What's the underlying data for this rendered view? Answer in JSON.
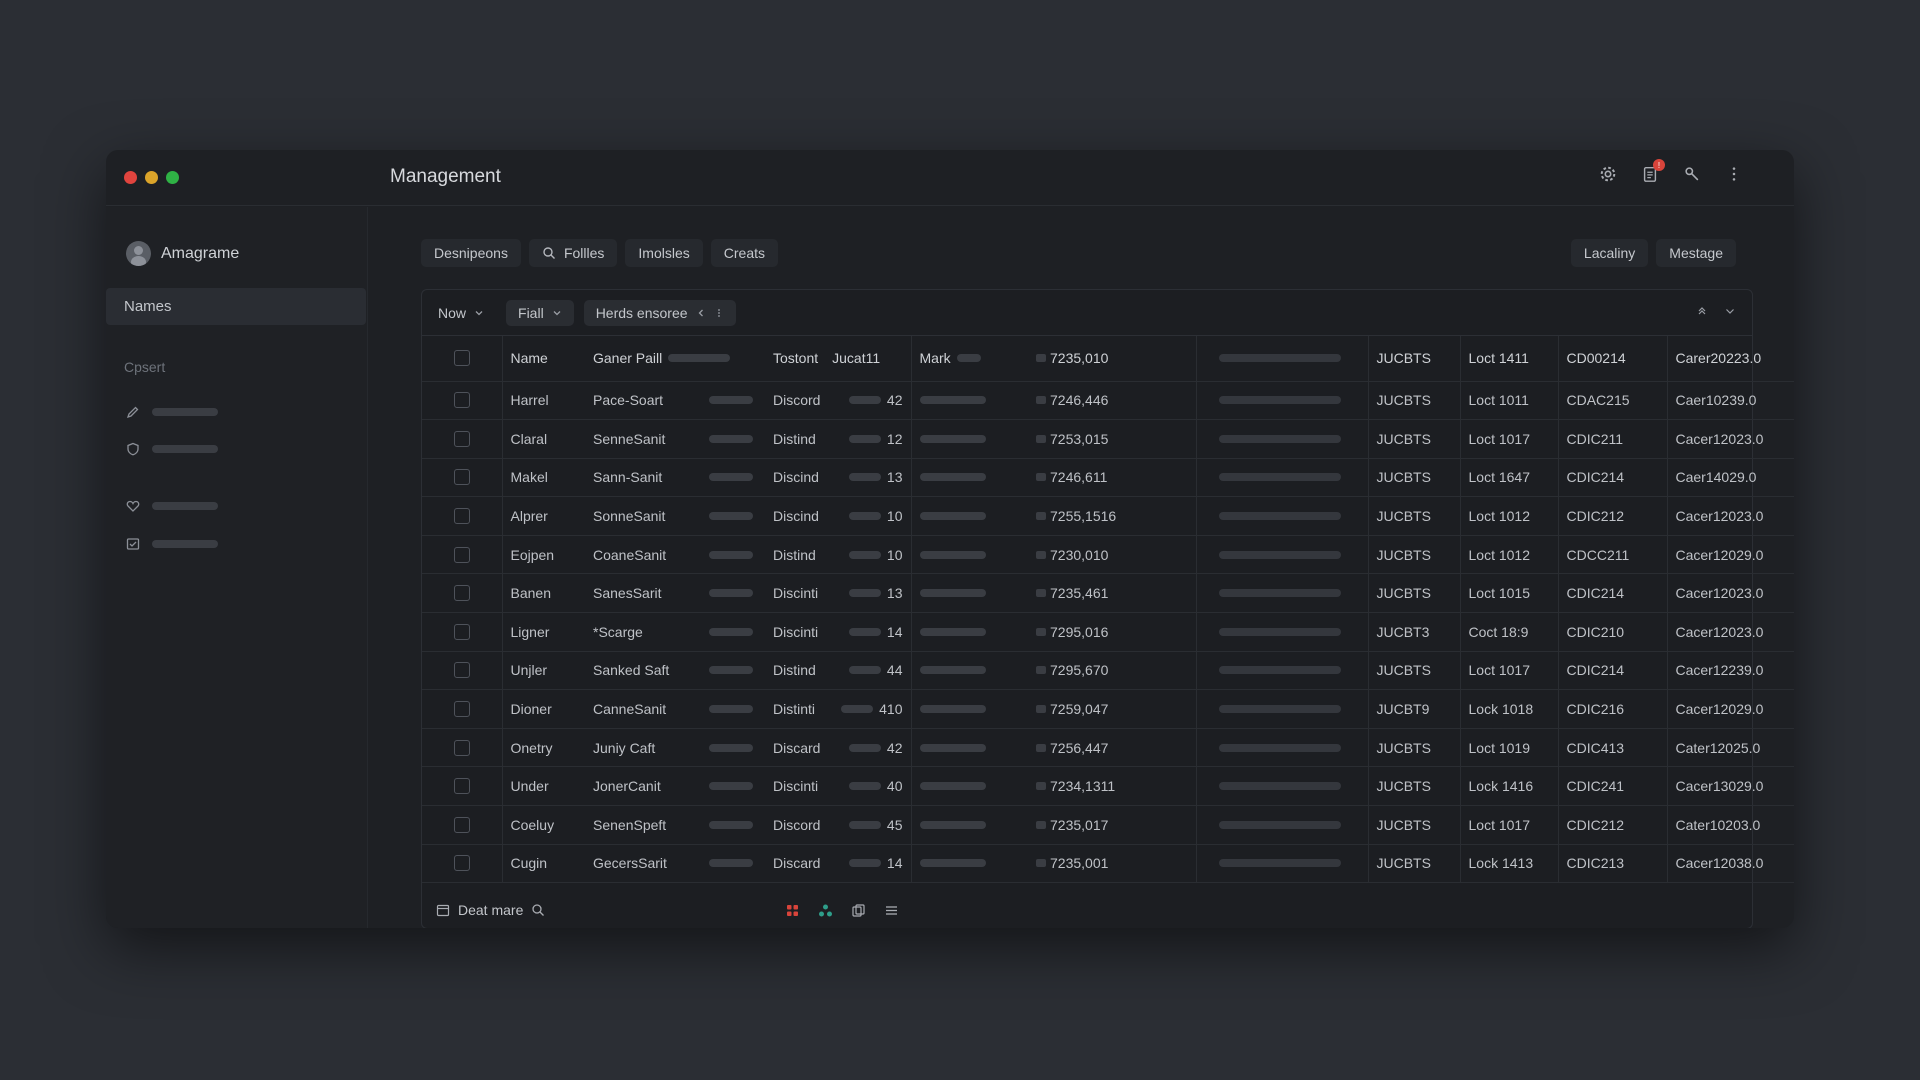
{
  "window": {
    "title": "Management",
    "traffic_colors": [
      "#e0443e",
      "#dba42a",
      "#2fb245"
    ],
    "actions": [
      {
        "icon": "gear-icon"
      },
      {
        "icon": "clipboard-icon",
        "badge": "!"
      },
      {
        "icon": "wrench-icon"
      },
      {
        "icon": "more-vertical-icon"
      }
    ]
  },
  "sidebar": {
    "profile_name": "Amagrame",
    "active_item": "Names",
    "section_label": "Cpsert",
    "items": [
      {
        "icon": "edit-icon"
      },
      {
        "icon": "shield-icon"
      },
      {
        "icon": "heart-icon"
      },
      {
        "icon": "checkbox-icon"
      }
    ]
  },
  "tabs": {
    "left": [
      "Desnipeons",
      "Follles",
      "Imolsles",
      "Creats"
    ],
    "search_tab_index": 1,
    "right": [
      "Lacaliny",
      "Mestage"
    ]
  },
  "filters": {
    "view": "Now",
    "field": "Fiall",
    "tag": "Herds ensoree"
  },
  "table": {
    "header": [
      "Name",
      "Ganer Paill",
      "Tostont",
      "Jucat11",
      "Mark",
      "7235,010",
      "JUCBTS",
      "Loct 1411",
      "CD00214",
      "Carer20223.0"
    ],
    "rows": [
      [
        "Harrel",
        "Pace-Soart",
        "Discord",
        "42",
        "7246,446",
        "JUCBTS",
        "Loct 1011",
        "CDAC215",
        "Caer10239.0"
      ],
      [
        "Claral",
        "SenneSanit",
        "Distind",
        "12",
        "7253,015",
        "JUCBTS",
        "Loct 1017",
        "CDIC211",
        "Cacer12023.0"
      ],
      [
        "Makel",
        "Sann-Sanit",
        "Discind",
        "13",
        "7246,611",
        "JUCBTS",
        "Loct 1647",
        "CDIC214",
        "Caer14029.0"
      ],
      [
        "Alprer",
        "SonneSanit",
        "Discind",
        "10",
        "7255,1516",
        "JUCBTS",
        "Loct 1012",
        "CDIC212",
        "Cacer12023.0"
      ],
      [
        "Eojpen",
        "CoaneSanit",
        "Distind",
        "10",
        "7230,010",
        "JUCBTS",
        "Loct 1012",
        "CDCC211",
        "Cacer12029.0"
      ],
      [
        "Banen",
        "SanesSarit",
        "Discinti",
        "13",
        "7235,461",
        "JUCBTS",
        "Loct 1015",
        "CDIC214",
        "Cacer12023.0"
      ],
      [
        "Ligner",
        "*Scarge",
        "Discinti",
        "14",
        "7295,016",
        "JUCBT3",
        "Coct 18:9",
        "CDIC210",
        "Cacer12023.0"
      ],
      [
        "Unjler",
        "Sanked Saft",
        "Distind",
        "44",
        "7295,670",
        "JUCBTS",
        "Loct 1017",
        "CDIC214",
        "Cacer12239.0"
      ],
      [
        "Dioner",
        "CanneSanit",
        "Distinti",
        "410",
        "7259,047",
        "JUCBT9",
        "Lock 1018",
        "CDIC216",
        "Cacer12029.0"
      ],
      [
        "Onetry",
        "Juniy Caft",
        "Discard",
        "42",
        "7256,447",
        "JUCBTS",
        "Loct 1019",
        "CDIC413",
        "Cater12025.0"
      ],
      [
        "Under",
        "JonerCanit",
        "Discinti",
        "40",
        "7234,1311",
        "JUCBTS",
        "Lock 1416",
        "CDIC241",
        "Cacer13029.0"
      ],
      [
        "Coeluy",
        "SenenSpeft",
        "Discord",
        "45",
        "7235,017",
        "JUCBTS",
        "Loct 1017",
        "CDIC212",
        "Cater10203.0"
      ],
      [
        "Cugin",
        "GecersSarit",
        "Discard",
        "14",
        "7235,001",
        "JUCBTS",
        "Lock 1413",
        "CDIC213",
        "Cacer12038.0"
      ]
    ]
  },
  "footer": {
    "label": "Deat mare",
    "tool_colors": [
      "#d8443b",
      "#2e9e8a",
      "#a9acb2",
      "#a9acb2"
    ]
  }
}
